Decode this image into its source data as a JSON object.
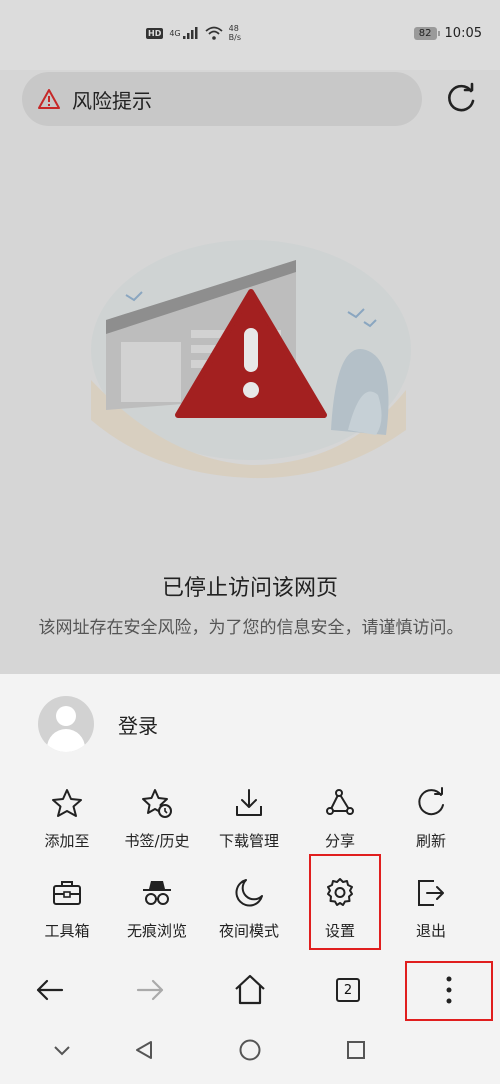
{
  "status_bar": {
    "network": "HD",
    "signal": "4G",
    "speed_value": "48",
    "speed_unit": "B/s",
    "battery": "82",
    "time": "10:05"
  },
  "risk_bar": {
    "label": "风险提示"
  },
  "page": {
    "title": "已停止访问该网页",
    "description": "该网址存在安全风险，为了您的信息安全，请谨慎访问。"
  },
  "menu": {
    "login_label": "登录",
    "items": [
      {
        "label": "添加至",
        "icon": "star-icon"
      },
      {
        "label": "书签/历史",
        "icon": "bookmark-history-icon"
      },
      {
        "label": "下载管理",
        "icon": "download-icon"
      },
      {
        "label": "分享",
        "icon": "share-icon"
      },
      {
        "label": "刷新",
        "icon": "refresh-icon"
      },
      {
        "label": "工具箱",
        "icon": "toolbox-icon"
      },
      {
        "label": "无痕浏览",
        "icon": "incognito-icon"
      },
      {
        "label": "夜间模式",
        "icon": "moon-icon"
      },
      {
        "label": "设置",
        "icon": "gear-icon"
      },
      {
        "label": "退出",
        "icon": "exit-icon"
      }
    ]
  },
  "nav": {
    "tab_count": "2"
  },
  "colors": {
    "highlight": "#e01e1e",
    "warning": "#c62828"
  }
}
